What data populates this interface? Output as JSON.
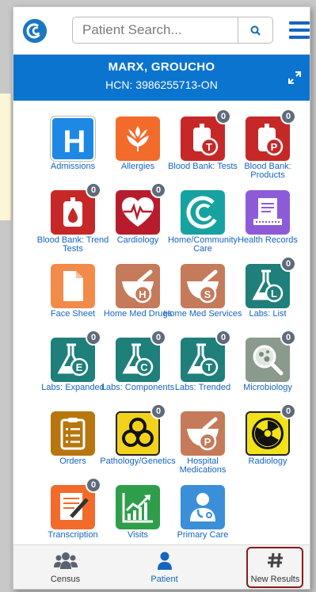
{
  "header": {
    "search_placeholder": "Patient Search...",
    "logo_icon": "c-logo-icon",
    "search_icon": "search-icon",
    "menu_icon": "hamburger-icon"
  },
  "patient": {
    "name": "MARX, GROUCHO",
    "hcn": "HCN: 3986255713-ON",
    "expand_icon": "expand-icon"
  },
  "tiles": [
    {
      "label": "Admissions",
      "icon": "hospital-h-icon",
      "color": "#1e88e5",
      "badge": ""
    },
    {
      "label": "Allergies",
      "icon": "wheat-icon",
      "color": "#f26b2a",
      "badge": ""
    },
    {
      "label": "Blood Bank: Tests",
      "icon": "blood-bag-t-icon",
      "color": "#c62828",
      "badge": "0"
    },
    {
      "label": "Blood Bank: Products",
      "icon": "blood-bag-p-icon",
      "color": "#c62828",
      "badge": "0"
    },
    {
      "label": "Blood Bank: Trend Tests",
      "icon": "blood-bag-drop-icon",
      "color": "#c62828",
      "badge": "0"
    },
    {
      "label": "Cardiology",
      "icon": "heart-monitor-icon",
      "color": "#b71c2c",
      "badge": "0"
    },
    {
      "label": "Home/Community Care",
      "icon": "home-care-icon",
      "color": "#17a2a2",
      "badge": ""
    },
    {
      "label": "Health Records",
      "icon": "health-records-icon",
      "color": "#8e5bd8",
      "badge": ""
    },
    {
      "label": "Face Sheet",
      "icon": "document-icon",
      "color": "#f28a4a",
      "badge": ""
    },
    {
      "label": "Home Med Drugs",
      "icon": "mortar-h-icon",
      "color": "#c57a5a",
      "badge": ""
    },
    {
      "label": "Home Med Services",
      "icon": "mortar-s-icon",
      "color": "#c57a5a",
      "badge": ""
    },
    {
      "label": "Labs: List",
      "icon": "flask-l-icon",
      "color": "#1f7f7a",
      "badge": "0"
    },
    {
      "label": "Labs: Expanded",
      "icon": "flask-e-icon",
      "color": "#1f7f7a",
      "badge": "0"
    },
    {
      "label": "Labs: Components",
      "icon": "flask-c-icon",
      "color": "#1f7f7a",
      "badge": "0"
    },
    {
      "label": "Labs: Trended",
      "icon": "flask-t-icon",
      "color": "#1f7f7a",
      "badge": "0"
    },
    {
      "label": "Microbiology",
      "icon": "microbe-magnifier-icon",
      "color": "#8a9a8c",
      "badge": "0"
    },
    {
      "label": "Orders",
      "icon": "clipboard-icon",
      "color": "#b8760f",
      "badge": ""
    },
    {
      "label": "Pathology/Genetics",
      "icon": "biohazard-icon",
      "color": "#f2d21a",
      "badge": "0"
    },
    {
      "label": "Hospital Medications",
      "icon": "mortar-p-icon",
      "color": "#c57a5a",
      "badge": ""
    },
    {
      "label": "Radiology",
      "icon": "radiation-icon",
      "color": "#f2e21a",
      "badge": "0"
    },
    {
      "label": "Transcription",
      "icon": "pen-paper-icon",
      "color": "#f26b2a",
      "badge": "0"
    },
    {
      "label": "Visits",
      "icon": "chart-up-icon",
      "color": "#2e9e4a",
      "badge": ""
    },
    {
      "label": "Primary Care",
      "icon": "doctor-icon",
      "color": "#3a8fd8",
      "badge": ""
    }
  ],
  "bottom_nav": [
    {
      "label": "Census",
      "icon": "people-icon"
    },
    {
      "label": "Patient",
      "icon": "person-icon"
    },
    {
      "label": "New Results",
      "icon": "hash-icon"
    }
  ],
  "colors": {
    "accent": "#0a74cf",
    "label_blue": "#1565c0",
    "highlight": "#8b1a1a"
  }
}
